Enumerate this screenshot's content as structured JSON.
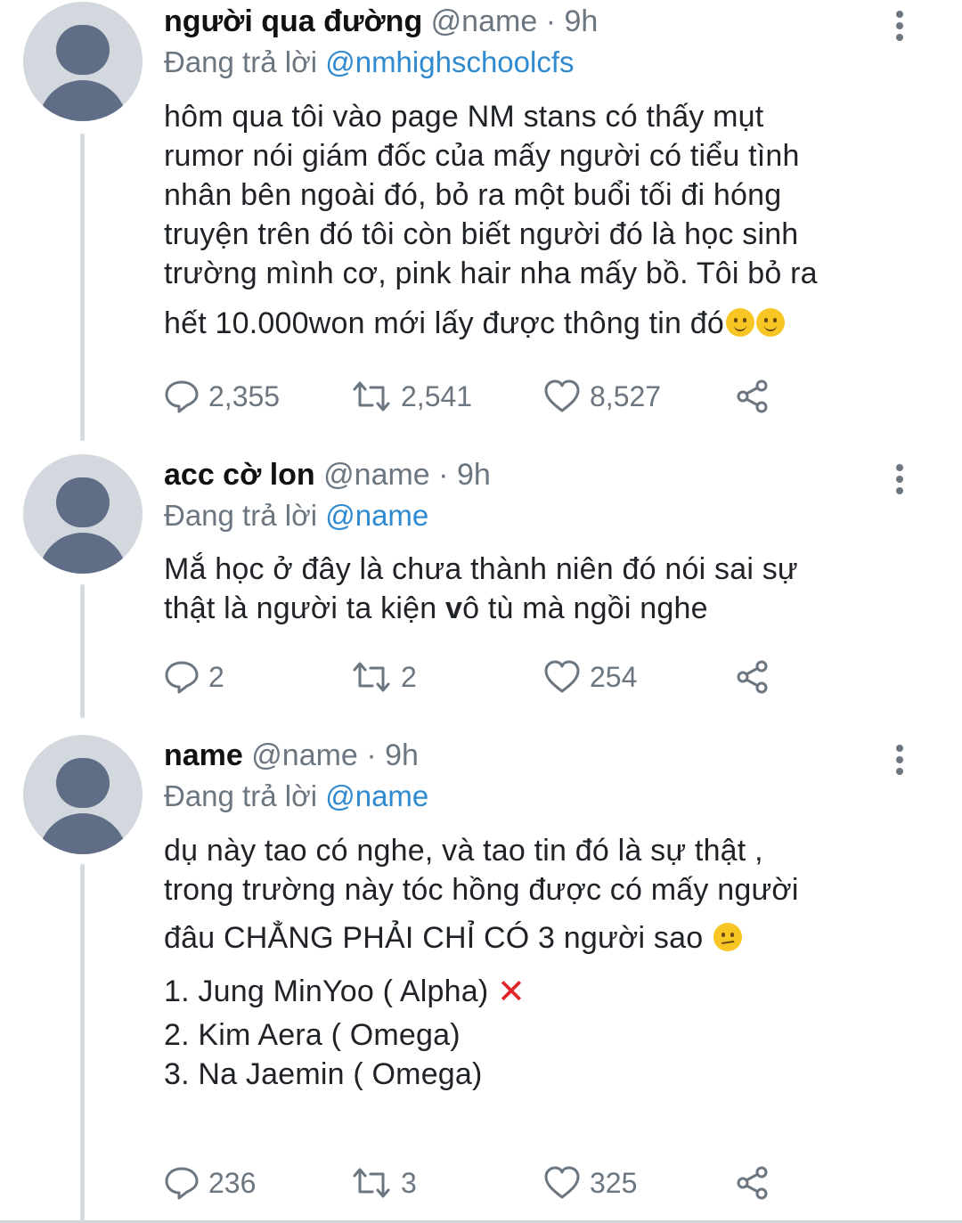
{
  "tweets": [
    {
      "display_name": "người qua đường",
      "handle": "@name",
      "time": "· 9h",
      "reply_prefix": "Đang trả lời",
      "reply_to": "@nmhighschoolcfs",
      "text_lines": [
        "hôm qua tôi vào page NM stans có thấy mụt",
        "rumor nói giám đốc của mấy người có tiểu tình",
        "nhân bên ngoài đó, bỏ ra một buổi tối đi hóng",
        "truyện trên đó tôi còn biết người đó là học sinh",
        "trường mình cơ, pink hair nha mấy bồ. Tôi bỏ ra",
        "hết 10.000won mới lấy được thông tin đó"
      ],
      "replies": "2,355",
      "retweets": "2,541",
      "likes": "8,527"
    },
    {
      "display_name": "acc cờ lon",
      "handle": "@name",
      "time": "· 9h",
      "reply_prefix": "Đang trả lời",
      "reply_to": "@name",
      "text_line1": "Mắ học ở đây là chưa thành niên đó nói sai sự",
      "text_line2_a": "thật là người ta kiện ",
      "text_line2_b": "v",
      "text_line2_c": "ô tù mà ngồi nghe",
      "replies": "2",
      "retweets": "2",
      "likes": "254"
    },
    {
      "display_name": "name",
      "handle": "@name",
      "time": "· 9h",
      "reply_prefix": "Đang trả lời",
      "reply_to": "@name",
      "text_lines": [
        "dụ này tao có nghe, và tao tin đó là sự thật ,",
        "trong trường này tóc hồng được có mấy người",
        "đâu CHẲNG PHẢI CHỈ CÓ 3 người sao"
      ],
      "list_items": [
        "1. Jung MinYoo ( Alpha)",
        "2. Kim Aera ( Omega)",
        "3. Na Jaemin ( Omega)"
      ],
      "list_mark": "✕",
      "replies": "236",
      "retweets": "3",
      "likes": "325"
    }
  ],
  "icons": {
    "reply": "reply-icon",
    "retweet": "retweet-icon",
    "like": "heart-icon",
    "share": "share-icon",
    "more": "more-options-icon"
  },
  "colors": {
    "mention": "#2f8ad0",
    "muted": "#6b7681",
    "avatar_bg": "#d3d8de",
    "avatar_fg": "#5f6e86",
    "cross": "#e0262a"
  }
}
